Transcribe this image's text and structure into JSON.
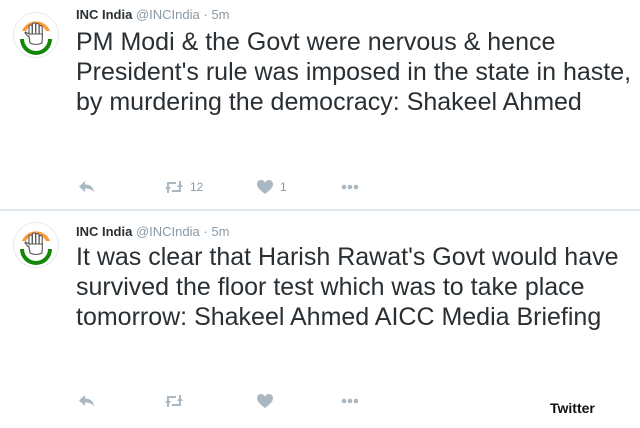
{
  "tweets": [
    {
      "name": "INC India",
      "handle": "@INCIndia",
      "separator": "·",
      "time": "5m",
      "text": "PM Modi & the Govt were nervous & hence President's rule was imposed in the state in haste, by murdering the democracy: Shakeel Ahmed",
      "retweet_count": "12",
      "like_count": "1"
    },
    {
      "name": "INC India",
      "handle": "@INCIndia",
      "separator": "·",
      "time": "5m",
      "text": "It was clear that Harish Rawat's Govt would have survived the floor test which was to take place tomorrow: Shakeel Ahmed AICC Media Briefing",
      "retweet_count": "",
      "like_count": ""
    }
  ],
  "brand_label": "Twitter",
  "colors": {
    "saffron": "#ff9933",
    "green": "#138808",
    "icon_gray": "#aab8c2",
    "text": "#292f33",
    "meta": "#8899a6"
  },
  "icons": {
    "avatar": "inc-hand-logo-icon",
    "reply": "reply-icon",
    "retweet": "retweet-icon",
    "like": "heart-icon",
    "more": "more-dots-icon"
  }
}
